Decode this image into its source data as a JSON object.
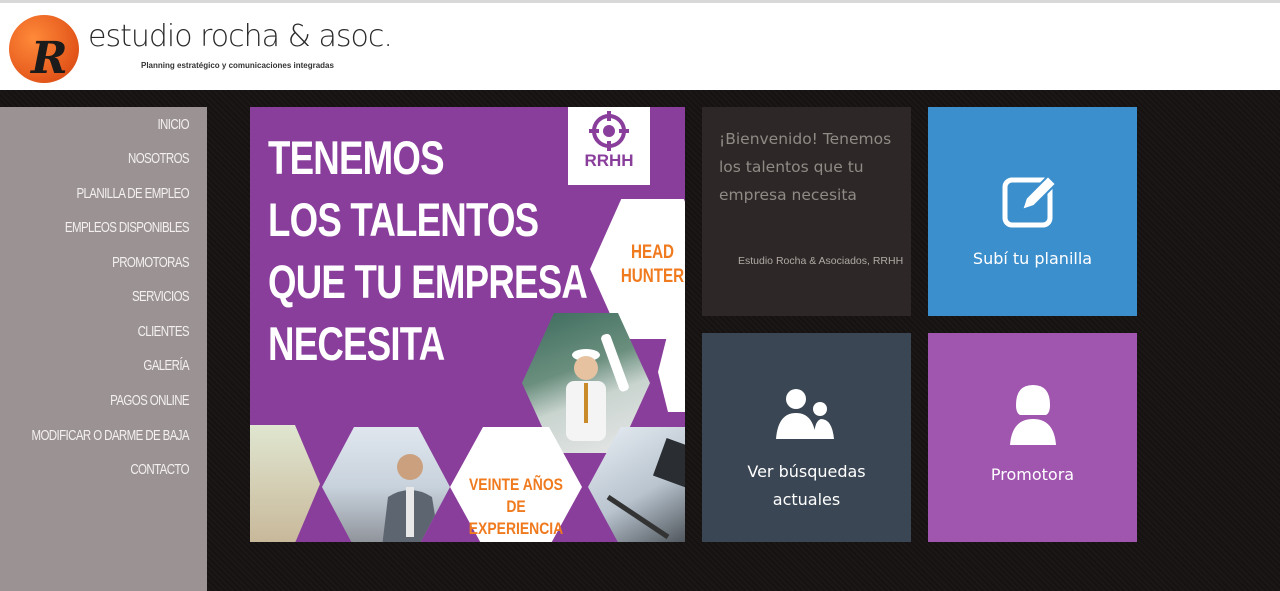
{
  "header": {
    "logo_letter": "R",
    "brand_name": "estudio rocha & asoc.",
    "tagline": "Planning estratégico y comunicaciones integradas"
  },
  "sidebar": {
    "items": [
      {
        "label": "INICIO"
      },
      {
        "label": "NOSOTROS"
      },
      {
        "label": "PLANILLA DE EMPLEO"
      },
      {
        "label": "EMPLEOS DISPONIBLES"
      },
      {
        "label": "PROMOTORAS"
      },
      {
        "label": "SERVICIOS"
      },
      {
        "label": "CLIENTES"
      },
      {
        "label": "GALERÍA"
      },
      {
        "label": "PAGOS ONLINE"
      },
      {
        "label": "MODIFICAR O DARME DE BAJA"
      },
      {
        "label": "CONTACTO"
      }
    ]
  },
  "banner": {
    "title_lines": [
      "TENEMOS",
      "LOS TALENTOS",
      "QUE TU EMPRESA",
      "NECESITA"
    ],
    "badge": "RRHH",
    "hex_head_hunter": [
      "HEAD",
      "HUNTER"
    ],
    "hex_experience": [
      "VEINTE AÑOS",
      "DE EXPERIENCIA"
    ]
  },
  "welcome": {
    "text": "¡Bienvenido! Tenemos los talentos que tu empresa necesita",
    "signature": "Estudio Rocha & Asociados, RRHH"
  },
  "tiles": {
    "upload_label": "Subí tu planilla",
    "search_label_1": "Ver búsquedas",
    "search_label_2": "actuales",
    "promo_label": "Promotora"
  },
  "colors": {
    "banner_purple": "#8a3e9c",
    "upload_blue": "#3c8fcd",
    "search_slate": "#3a4653",
    "promo_purple": "#a056af",
    "accent_orange": "#f07a1e"
  }
}
